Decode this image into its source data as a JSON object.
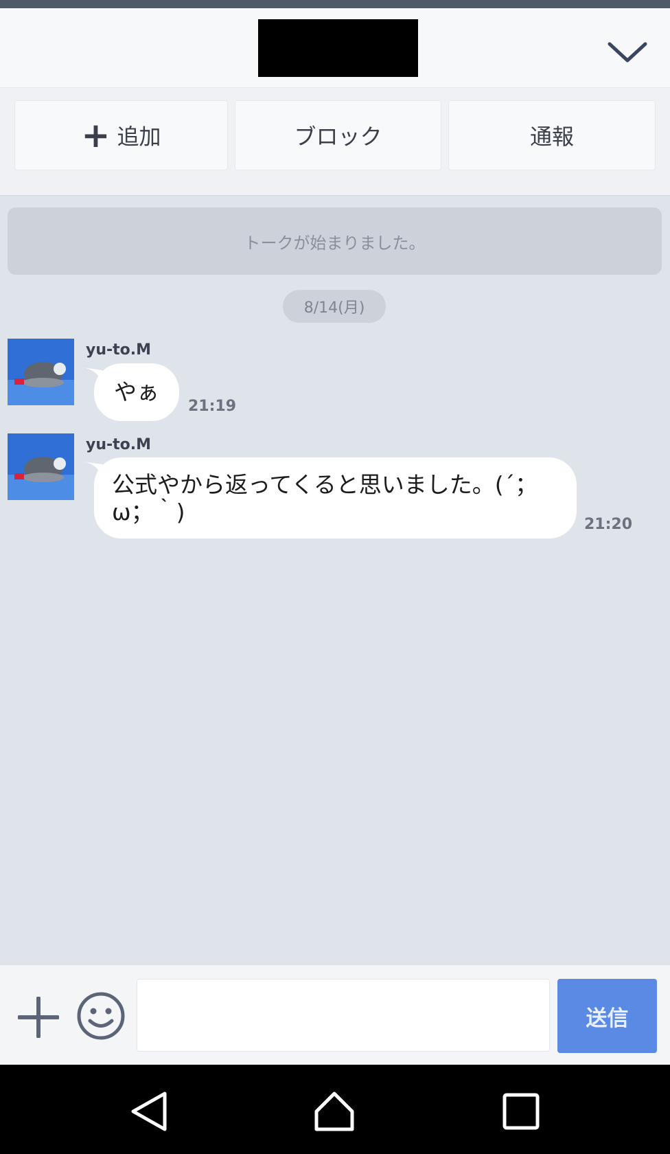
{
  "header": {
    "title_redacted": true,
    "collapse_icon": "chevron-down-icon"
  },
  "actions": {
    "add_label": "追加",
    "block_label": "ブロック",
    "report_label": "通報"
  },
  "system_message": "トークが始まりました。",
  "date_divider": "8/14(月)",
  "messages": [
    {
      "sender": "yu-to.M",
      "text": "やぁ",
      "time": "21:19"
    },
    {
      "sender": "yu-to.M",
      "text_line1": "公式やから返ってくると思いました。(´；",
      "text_line2": "ω；｀)",
      "time": "21:20"
    }
  ],
  "input": {
    "value": "",
    "placeholder": ""
  },
  "send_label": "送信",
  "icons": {
    "attach": "plus-icon",
    "sticker": "emoji-icon",
    "nav_back": "back-triangle-icon",
    "nav_home": "home-icon",
    "nav_recents": "recents-square-icon"
  },
  "colors": {
    "chat_background": "#dfe3ea",
    "send_button": "#5a8ae4",
    "bubble": "#ffffff"
  }
}
